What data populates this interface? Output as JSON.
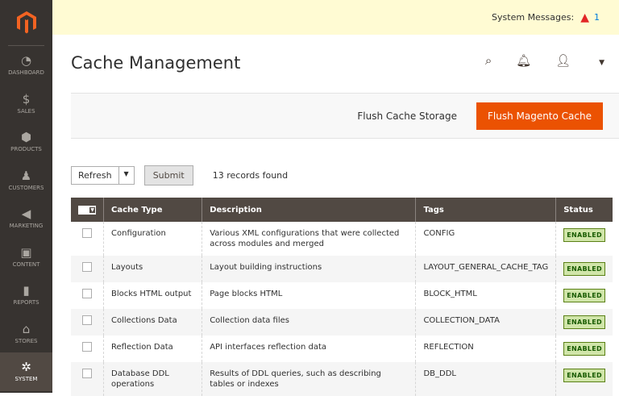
{
  "sidebar": {
    "items": [
      {
        "label": "Dashboard",
        "icon": "dashboard-icon",
        "glyph": "◔"
      },
      {
        "label": "Sales",
        "icon": "dollar-icon",
        "glyph": "$"
      },
      {
        "label": "Products",
        "icon": "box-icon",
        "glyph": "⬢"
      },
      {
        "label": "Customers",
        "icon": "person-icon",
        "glyph": "♟"
      },
      {
        "label": "Marketing",
        "icon": "megaphone-icon",
        "glyph": "◀"
      },
      {
        "label": "Content",
        "icon": "layout-icon",
        "glyph": "▣"
      },
      {
        "label": "Reports",
        "icon": "bar-chart-icon",
        "glyph": "▮"
      },
      {
        "label": "Stores",
        "icon": "store-icon",
        "glyph": "⌂"
      },
      {
        "label": "System",
        "icon": "gear-icon",
        "glyph": "✲"
      }
    ]
  },
  "banner": {
    "label": "System Messages:",
    "count": "1"
  },
  "header": {
    "title": "Cache Management"
  },
  "actions": {
    "flush_storage": "Flush Cache Storage",
    "flush_magento": "Flush Magento Cache"
  },
  "toolbar": {
    "action": "Refresh",
    "submit": "Submit",
    "records": "13 records found"
  },
  "table": {
    "columns": [
      "Cache Type",
      "Description",
      "Tags",
      "Status"
    ],
    "rows": [
      {
        "type": "Configuration",
        "desc": "Various XML configurations that were collected across modules and merged",
        "tags": "CONFIG",
        "status": "ENABLED"
      },
      {
        "type": "Layouts",
        "desc": "Layout building instructions",
        "tags": "LAYOUT_GENERAL_CACHE_TAG",
        "status": "ENABLED"
      },
      {
        "type": "Blocks HTML output",
        "desc": "Page blocks HTML",
        "tags": "BLOCK_HTML",
        "status": "ENABLED"
      },
      {
        "type": "Collections Data",
        "desc": "Collection data files",
        "tags": "COLLECTION_DATA",
        "status": "ENABLED"
      },
      {
        "type": "Reflection Data",
        "desc": "API interfaces reflection data",
        "tags": "REFLECTION",
        "status": "ENABLED"
      },
      {
        "type": "Database DDL operations",
        "desc": "Results of DDL queries, such as describing tables or indexes",
        "tags": "DB_DDL",
        "status": "ENABLED"
      }
    ]
  }
}
